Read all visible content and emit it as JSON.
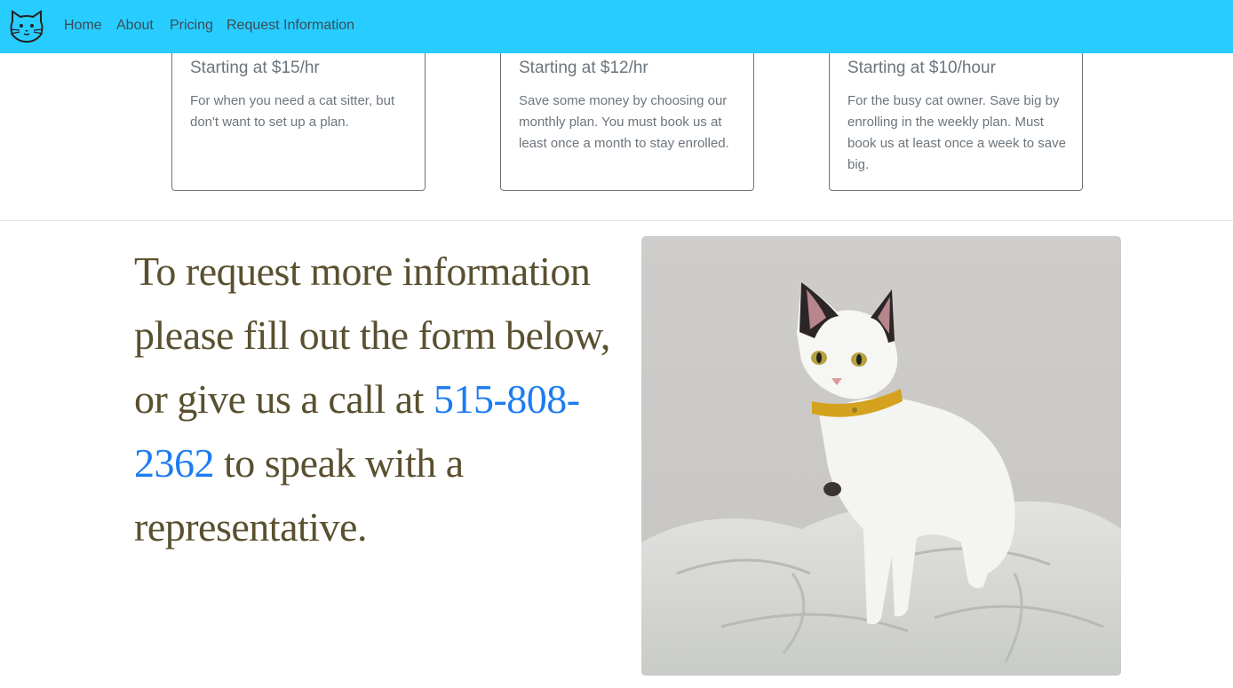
{
  "nav": {
    "logo_icon": "cat-face-icon",
    "links": [
      "Home",
      "About",
      "Pricing",
      "Request Information"
    ],
    "background": "#28cdff"
  },
  "pricing": {
    "cards": [
      {
        "title": "Starting at $15/hr",
        "text": "For when you need a cat sitter, but don't want to set up a plan."
      },
      {
        "title": "Starting at $12/hr",
        "text": "Save some money by choosing our monthly plan. You must book us at least once a month to stay enrolled."
      },
      {
        "title": "Starting at $10/hour",
        "text": "For the busy cat owner. Save big by enrolling in the weekly plan. Must book us at least once a week to save big."
      }
    ]
  },
  "request": {
    "text_before": "To request more information please fill out the form below, or give us a call at ",
    "phone": "515-808-2362",
    "text_after": " to speak with a representative."
  },
  "photo": {
    "icon": "cat-photo"
  },
  "colors": {
    "accent": "#28cdff",
    "link": "#1d7cf2",
    "heading": "#5a5030",
    "muted": "#6c757d"
  }
}
